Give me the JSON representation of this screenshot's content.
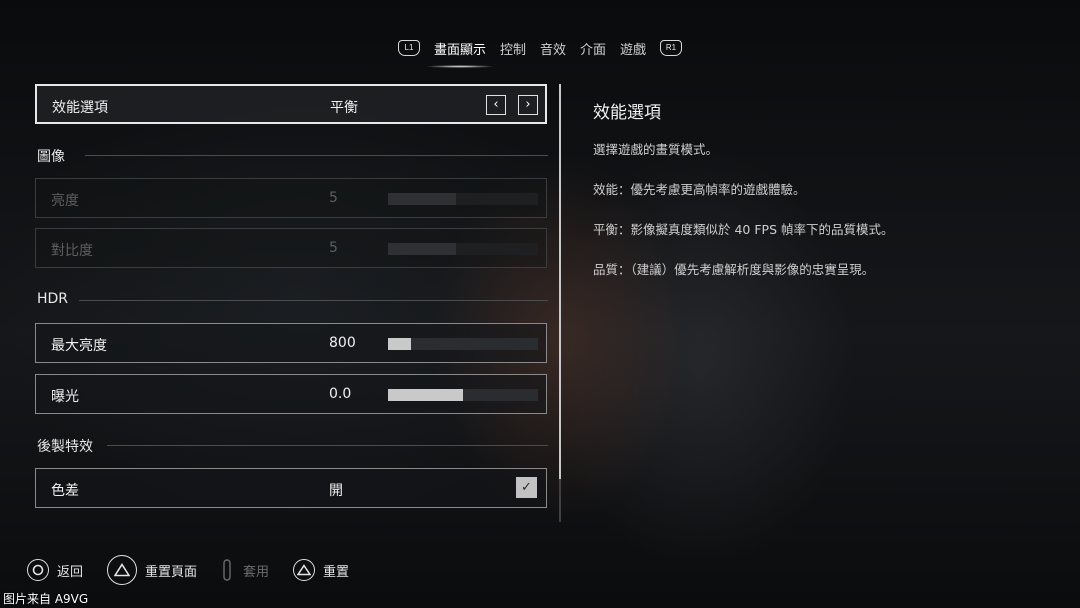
{
  "tabs": {
    "left_shoulder": "L1",
    "right_shoulder": "R1",
    "items": [
      "畫面顯示",
      "控制",
      "音效",
      "介面",
      "遊戲"
    ],
    "active_index": 0
  },
  "settings": {
    "performance": {
      "label": "效能選項",
      "value": "平衡"
    },
    "section_image": "圖像",
    "brightness": {
      "label": "亮度",
      "value": "5",
      "level": 0.45
    },
    "contrast": {
      "label": "對比度",
      "value": "5",
      "level": 0.45
    },
    "section_hdr": "HDR",
    "max_brightness": {
      "label": "最大亮度",
      "value": "800",
      "level": 0.15
    },
    "exposure": {
      "label": "曝光",
      "value": "0.0",
      "level": 0.5
    },
    "section_post": "後製特效",
    "chromatic": {
      "label": "色差",
      "value": "開",
      "checked": true
    }
  },
  "description": {
    "title": "效能選項",
    "lines": [
      "選擇遊戲的畫質模式。",
      "效能：優先考慮更高幀率的遊戲體驗。",
      "平衡：影像擬真度類似於 40 FPS 幀率下的品質模式。",
      "品質：（建議）優先考慮解析度與影像的忠實呈現。"
    ]
  },
  "bottom": {
    "back": "返回",
    "reset_page": "重置頁面",
    "apply": "套用",
    "reset": "重置"
  },
  "credit": "图片来自 A9VG",
  "colors": {
    "accent": "#e8e8e8",
    "background": "#0d0f12"
  }
}
